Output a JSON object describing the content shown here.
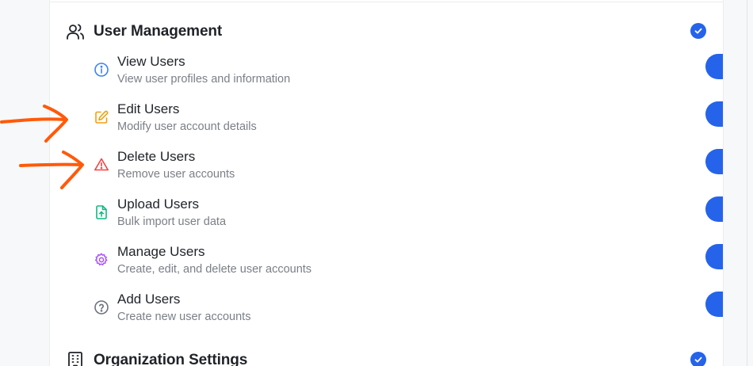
{
  "section": {
    "title": "User Management",
    "icon": "users-icon",
    "checked": true
  },
  "permissions": [
    {
      "title": "View Users",
      "description": "View user profiles and information",
      "icon": "info-icon",
      "color": "#3b82f6",
      "enabled": true
    },
    {
      "title": "Edit Users",
      "description": "Modify user account details",
      "icon": "edit-icon",
      "color": "#f59e0b",
      "enabled": true
    },
    {
      "title": "Delete Users",
      "description": "Remove user accounts",
      "icon": "warning-icon",
      "color": "#ef4444",
      "enabled": true
    },
    {
      "title": "Upload Users",
      "description": "Bulk import user data",
      "icon": "file-upload-icon",
      "color": "#10b981",
      "enabled": true
    },
    {
      "title": "Manage Users",
      "description": "Create, edit, and delete user accounts",
      "icon": "gear-icon",
      "color": "#a855f7",
      "enabled": true
    },
    {
      "title": "Add Users",
      "description": "Create new user accounts",
      "icon": "help-circle-icon",
      "color": "#6b7280",
      "enabled": true
    }
  ],
  "next_section": {
    "title": "Organization Settings",
    "icon": "building-icon",
    "checked": true
  },
  "colors": {
    "accent": "#2563eb",
    "annotation": "#ff5a0a"
  }
}
